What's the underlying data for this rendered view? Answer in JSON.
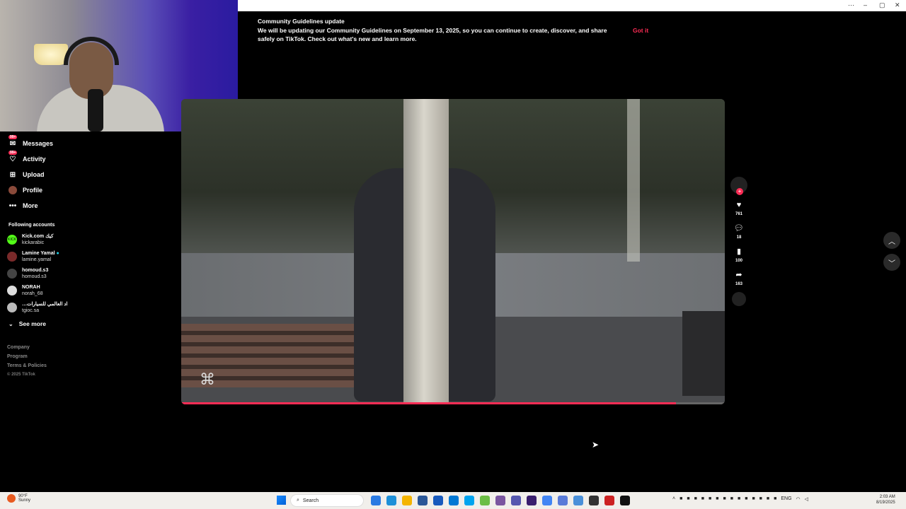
{
  "banner": {
    "title": "Community Guidelines update",
    "text": "We will be updating our Community Guidelines on September 13, 2025, so you can continue to create, discover, and share safely on TikTok. Check out what's new and learn more.",
    "button": "Got it"
  },
  "nav": {
    "messages": "Messages",
    "messages_badge": "99+",
    "activity": "Activity",
    "activity_badge": "99+",
    "upload": "Upload",
    "profile": "Profile",
    "more": "More"
  },
  "following": {
    "title": "Following accounts",
    "accounts": [
      {
        "name": "Kick.com كيك",
        "user": "kickarabic"
      },
      {
        "name": "Lamine Yamal",
        "user": "lamine.yamal"
      },
      {
        "name": "homoud.s3",
        "user": "homoud.s3"
      },
      {
        "name": "NORAH",
        "user": "norah_68"
      },
      {
        "name": "…اد العالمي للسيارات",
        "user": "tgioc.sa"
      }
    ],
    "see_more": "See more"
  },
  "footer": {
    "company": "Company",
    "program": "Program",
    "terms": "Terms & Policies",
    "copyright": "© 2025 TikTok"
  },
  "video": {
    "progress": 0.91,
    "likes": "761",
    "comments": "18",
    "saves": "100",
    "shares": "163"
  },
  "taskbar": {
    "weather_temp": "90°F",
    "weather_desc": "Sunny",
    "search_placeholder": "Search",
    "lang": "ENG",
    "time": "2:03 AM",
    "date": "8/19/2025"
  },
  "colors": {
    "accent": "#fe2c55"
  }
}
